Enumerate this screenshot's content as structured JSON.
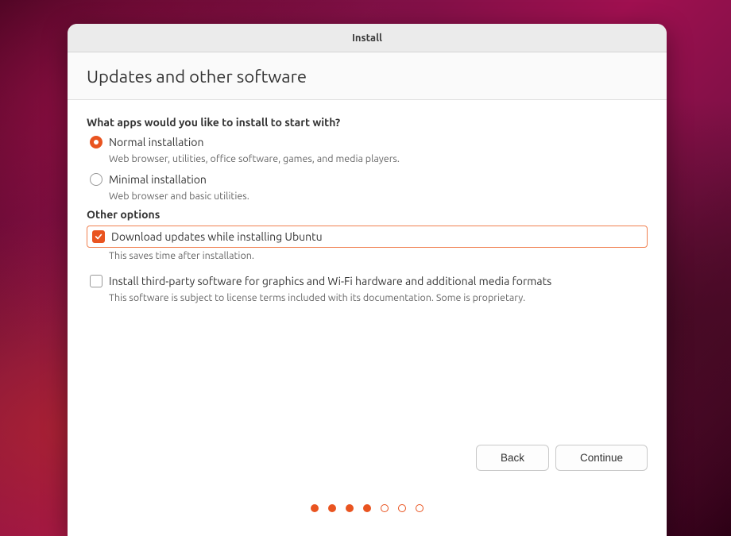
{
  "titlebar": {
    "title": "Install"
  },
  "header": {
    "title": "Updates and other software"
  },
  "section_apps": {
    "title": "What apps would you like to install to start with?",
    "normal": {
      "label": "Normal installation",
      "description": "Web browser, utilities, office software, games, and media players.",
      "checked": true
    },
    "minimal": {
      "label": "Minimal installation",
      "description": "Web browser and basic utilities.",
      "checked": false
    }
  },
  "section_other": {
    "title": "Other options",
    "download_updates": {
      "label": "Download updates while installing Ubuntu",
      "description": "This saves time after installation.",
      "checked": true
    },
    "third_party": {
      "label": "Install third-party software for graphics and Wi-Fi hardware and additional media formats",
      "description": "This software is subject to license terms included with its documentation. Some is proprietary.",
      "checked": false
    }
  },
  "buttons": {
    "back": "Back",
    "continue": "Continue"
  },
  "pagination": {
    "total": 7,
    "current": 4
  }
}
